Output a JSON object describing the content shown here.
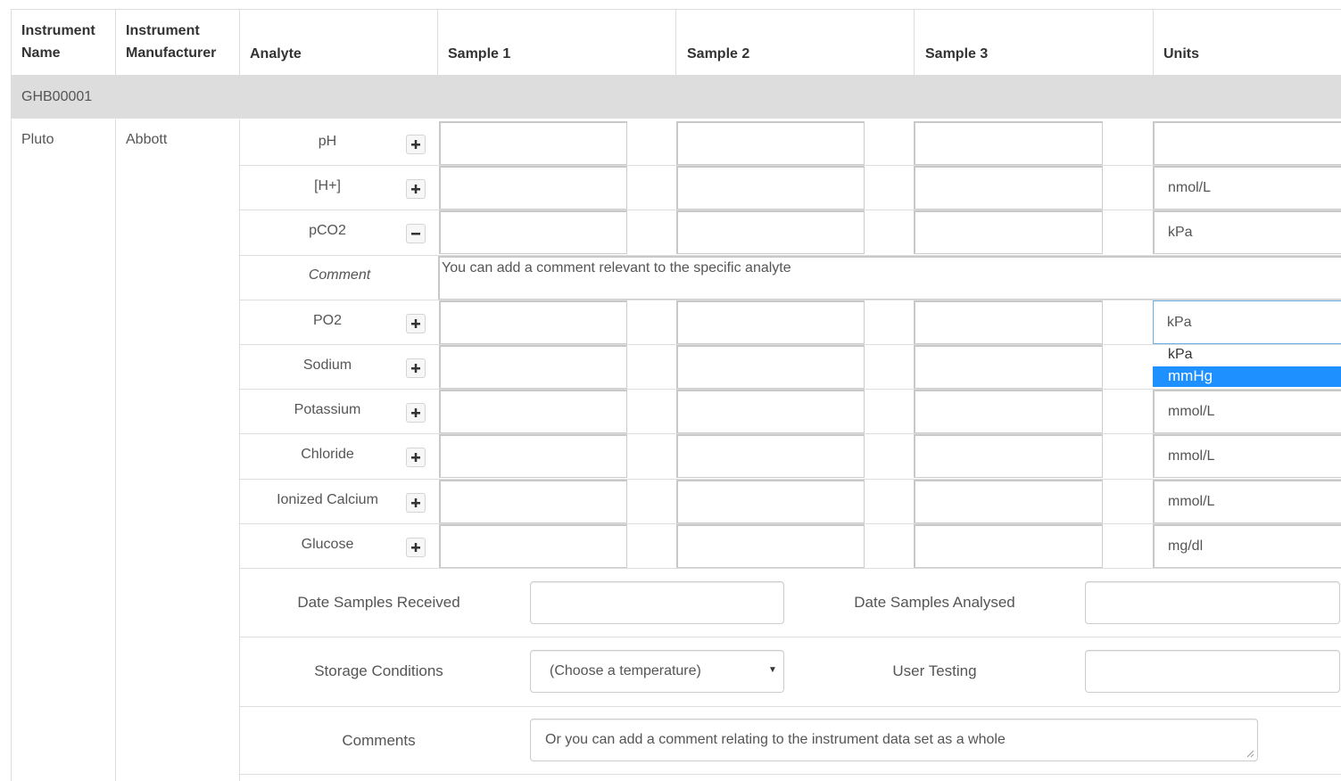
{
  "table": {
    "headers": {
      "instrument_name": [
        "Instrument",
        "Name"
      ],
      "instrument_manufacturer": [
        "Instrument",
        "Manufacturer"
      ],
      "analyte": "Analyte",
      "sample1": "Sample 1",
      "sample2": "Sample 2",
      "sample3": "Sample 3",
      "units": "Units"
    },
    "group_id": "GHB00001",
    "instrument": {
      "name": "Pluto",
      "manufacturer": "Abbott"
    },
    "analytes": [
      {
        "label": "pH",
        "toggle": "+",
        "unit": ""
      },
      {
        "label": "[H+]",
        "toggle": "+",
        "unit": "nmol/L"
      },
      {
        "label": "pCO2",
        "toggle": "−",
        "unit": "kPa"
      },
      {
        "label": "PO2",
        "toggle": "+",
        "unit": "kPa"
      },
      {
        "label": "Sodium",
        "toggle": "+",
        "unit": ""
      },
      {
        "label": "Potassium",
        "toggle": "+",
        "unit": "mmol/L"
      },
      {
        "label": "Chloride",
        "toggle": "+",
        "unit": "mmol/L"
      },
      {
        "label": "Ionized Calcium",
        "toggle": "+",
        "unit": "mmol/L"
      },
      {
        "label": "Glucose",
        "toggle": "+",
        "unit": "mg/dl"
      }
    ],
    "analyte_comment": {
      "label": "Comment",
      "value": "You can add a comment relevant to the specific analyte"
    },
    "unit_dropdown": {
      "options": [
        "kPa",
        "mmHg"
      ],
      "highlighted": "mmHg",
      "highlight_color": "#1e90ff"
    }
  },
  "footer": {
    "date_received_label": "Date Samples Received",
    "date_analysed_label": "Date Samples Analysed",
    "storage_label": "Storage Conditions",
    "storage_value": "(Choose a temperature)",
    "user_testing_label": "User Testing",
    "comments_label": "Comments",
    "comments_value": "Or you can add a comment relating to the instrument data set as a whole"
  },
  "colors": {
    "group_row_bg": "#dddddd",
    "border": "#dddddd",
    "input_border": "#cccccc"
  }
}
